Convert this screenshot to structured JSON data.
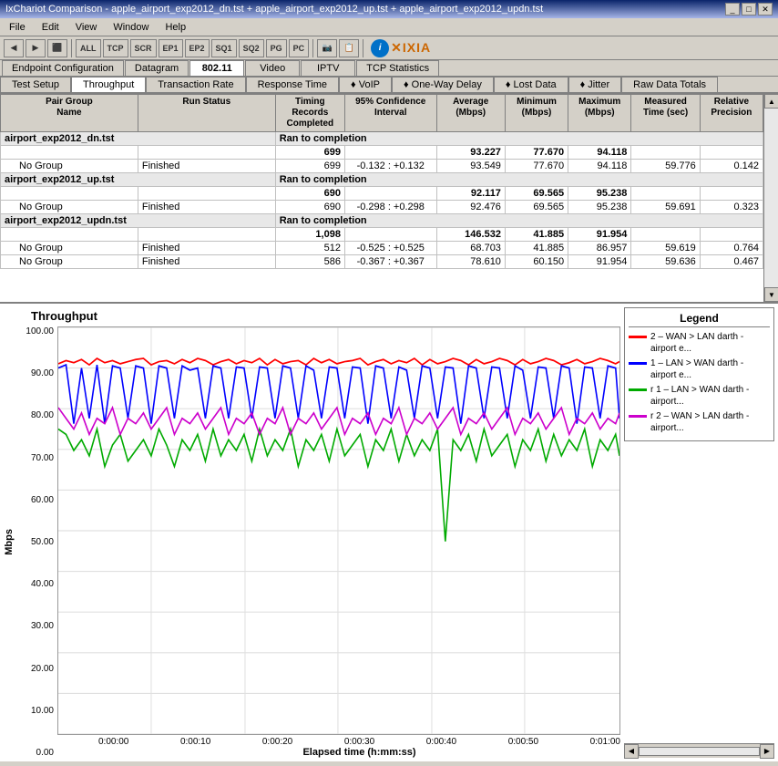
{
  "window": {
    "title": "IxChariot Comparison - apple_airport_exp2012_dn.tst + apple_airport_exp2012_up.tst + apple_airport_exp2012_updn.tst"
  },
  "menu": {
    "items": [
      "File",
      "Edit",
      "View",
      "Window",
      "Help"
    ]
  },
  "toolbar": {
    "buttons": [
      "◀",
      "▶",
      "⬛"
    ],
    "text_buttons": [
      "ALL",
      "TCP",
      "SCR",
      "EP1",
      "EP2",
      "SQ1",
      "SQ2",
      "PG",
      "PC"
    ]
  },
  "tabs": {
    "top": [
      "Endpoint Configuration",
      "Datagram",
      "802.11",
      "Video",
      "IPTV",
      "TCP Statistics"
    ],
    "bottom": [
      "Test Setup",
      "Throughput",
      "Transaction Rate",
      "Response Time",
      "VoIP",
      "One-Way Delay",
      "Lost Data",
      "Jitter",
      "Raw Data Totals"
    ]
  },
  "table": {
    "headers": [
      "Pair Group Name",
      "Run Status",
      "Timing Records Completed",
      "95% Confidence Interval",
      "Average (Mbps)",
      "Minimum (Mbps)",
      "Maximum (Mbps)",
      "Measured Time (sec)",
      "Relative Precision"
    ],
    "rows": [
      {
        "type": "file",
        "name": "airport_exp2012_dn.tst",
        "status": "Ran to completion",
        "records": "",
        "ci": "",
        "avg": "",
        "min": "",
        "max": "",
        "time": "",
        "precision": ""
      },
      {
        "type": "summary",
        "name": "",
        "group": "",
        "status": "",
        "records": "699",
        "ci": "",
        "avg": "93.227",
        "min": "77.670",
        "max": "94.118",
        "time": "",
        "precision": ""
      },
      {
        "type": "data",
        "name": "",
        "group": "No Group",
        "status": "Finished",
        "records": "699",
        "ci": "-0.132 : +0.132",
        "avg": "93.549",
        "min": "77.670",
        "max": "94.118",
        "time": "59.776",
        "precision": "0.142"
      },
      {
        "type": "file",
        "name": "airport_exp2012_up.tst",
        "status": "Ran to completion",
        "records": "",
        "ci": "",
        "avg": "",
        "min": "",
        "max": "",
        "time": "",
        "precision": ""
      },
      {
        "type": "summary",
        "name": "",
        "group": "",
        "status": "",
        "records": "690",
        "ci": "",
        "avg": "92.117",
        "min": "69.565",
        "max": "95.238",
        "time": "",
        "precision": ""
      },
      {
        "type": "data",
        "name": "",
        "group": "No Group",
        "status": "Finished",
        "records": "690",
        "ci": "-0.298 : +0.298",
        "avg": "92.476",
        "min": "69.565",
        "max": "95.238",
        "time": "59.691",
        "precision": "0.323"
      },
      {
        "type": "file",
        "name": "airport_exp2012_updn.tst",
        "status": "Ran to completion",
        "records": "",
        "ci": "",
        "avg": "",
        "min": "",
        "max": "",
        "time": "",
        "precision": ""
      },
      {
        "type": "summary",
        "name": "",
        "group": "",
        "status": "",
        "records": "1,098",
        "ci": "",
        "avg": "146.532",
        "min": "41.885",
        "max": "91.954",
        "time": "",
        "precision": ""
      },
      {
        "type": "data",
        "name": "",
        "group": "No Group",
        "status": "Finished",
        "records": "512",
        "ci": "-0.525 : +0.525",
        "avg": "68.703",
        "min": "41.885",
        "max": "86.957",
        "time": "59.619",
        "precision": "0.764"
      },
      {
        "type": "data",
        "name": "",
        "group": "No Group",
        "status": "Finished",
        "records": "586",
        "ci": "-0.367 : +0.367",
        "avg": "78.610",
        "min": "60.150",
        "max": "91.954",
        "time": "59.636",
        "precision": "0.467"
      }
    ]
  },
  "chart": {
    "title": "Throughput",
    "y_axis_label": "Mbps",
    "y_ticks": [
      "100.00",
      "90.00",
      "80.00",
      "70.00",
      "60.00",
      "50.00",
      "40.00",
      "30.00",
      "20.00",
      "10.00",
      "0.00"
    ],
    "x_ticks": [
      "0:00:00",
      "0:00:10",
      "0:00:20",
      "0:00:30",
      "0:00:40",
      "0:00:50",
      "0:01:00"
    ],
    "x_label": "Elapsed time (h:mm:ss)"
  },
  "legend": {
    "title": "Legend",
    "items": [
      {
        "color": "#ff0000",
        "label": "2 - WAN > LAN darth - airport e..."
      },
      {
        "color": "#0000ff",
        "label": "1 - LAN > WAN darth - airport e..."
      },
      {
        "color": "#00aa00",
        "label": "r 1 - LAN > WAN darth - airport..."
      },
      {
        "color": "#cc00cc",
        "label": "r 2 - WAN > LAN darth - airport..."
      }
    ]
  },
  "colors": {
    "bg": "#d4d0c8",
    "white": "#ffffff",
    "border": "#808080",
    "title_bar": "#0a246a",
    "chart_red": "#ff0000",
    "chart_blue": "#0000ff",
    "chart_green": "#00aa00",
    "chart_magenta": "#cc00cc"
  }
}
